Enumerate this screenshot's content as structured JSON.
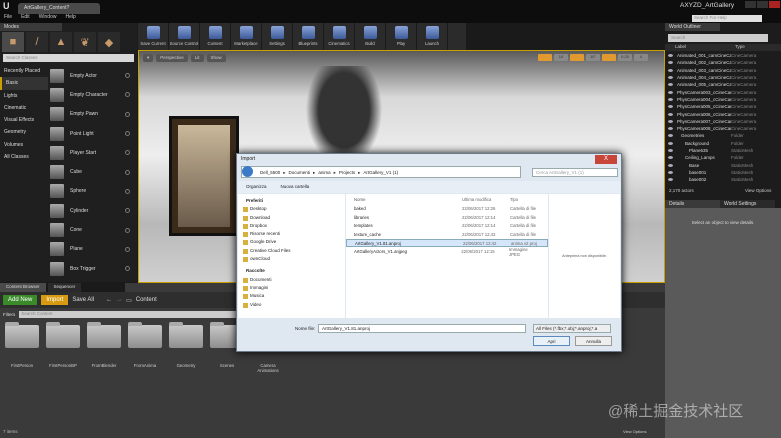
{
  "app": {
    "logo": "U",
    "tab_title": "ArtGallery_Content?",
    "project": "AXYZD_ArtGallery",
    "menu": [
      "File",
      "Edit",
      "Window",
      "Help"
    ],
    "help_placeholder": "Search For Help"
  },
  "modes": {
    "tab": "Modes",
    "search_placeholder": "Search Classes",
    "categories": [
      "Recently Placed",
      "Basic",
      "Lights",
      "Cinematic",
      "Visual Effects",
      "Geometry",
      "Volumes",
      "All Classes"
    ],
    "selected_category": "Basic",
    "items": [
      "Empty Actor",
      "Empty Character",
      "Empty Pawn",
      "Point Light",
      "Player Start",
      "Cube",
      "Sphere",
      "Cylinder",
      "Cone",
      "Plane",
      "Box Trigger"
    ]
  },
  "toolbar": [
    "Save Current",
    "Source Control",
    "Content",
    "Marketplace",
    "Settings",
    "Blueprints",
    "Cinematics",
    "Build",
    "Play",
    "Launch"
  ],
  "viewport": {
    "buttons": [
      "Perspective",
      "Lit",
      "Show"
    ],
    "right_values": [
      "10",
      "10°",
      "0.25",
      "4"
    ]
  },
  "outliner": {
    "tab": "World Outliner",
    "search_placeholder": "Search",
    "col_label": "Label",
    "col_type": "Type",
    "rows": [
      [
        "Animated_001_camCineCamera",
        "CineCamera"
      ],
      [
        "Animated_002_camCineCamera",
        "CineCamera"
      ],
      [
        "Animated_003_camCineCamera",
        "CineCamera"
      ],
      [
        "Animated_004_camCineCamera",
        "CineCamera"
      ],
      [
        "Animated_005_camCineCamera",
        "CineCamera"
      ],
      [
        "PhysCamera003_cCineCamera",
        "CineCamera"
      ],
      [
        "PhysCamera004_cCineCamera",
        "CineCamera"
      ],
      [
        "PhysCamera005_cCineCamera",
        "CineCamera"
      ],
      [
        "PhysCamera006_cCineCamera",
        "CineCamera"
      ],
      [
        "PhysCamera007_cCineCamera",
        "CineCamera"
      ],
      [
        "PhysCamera008_cCineCamera",
        "CineCamera"
      ],
      [
        "Geometries",
        "Folder"
      ],
      [
        "Background",
        "Folder"
      ],
      [
        "Plane635",
        "StaticMesh"
      ],
      [
        "Ceiling_Lamps",
        "Folder"
      ],
      [
        "Base",
        "StaticMesh"
      ],
      [
        "base001",
        "StaticMesh"
      ],
      [
        "base002",
        "StaticMesh"
      ]
    ],
    "count": "2,170 actors",
    "view_options": "View Options"
  },
  "details": {
    "tab": "Details",
    "tab2": "World Settings",
    "empty": "Select an object to view details."
  },
  "content_browser": {
    "tabs": [
      "Content Browser",
      "Sequencer"
    ],
    "add_new": "Add New",
    "import": "Import",
    "save_all": "Save All",
    "path": "Content",
    "filters": "Filters",
    "search_placeholder": "Search Content",
    "folders": [
      "FirstPerson",
      "FirstPersonBP",
      "FromBlender",
      "FromAnima",
      "Geometry",
      "Scenes",
      "Camera Animations"
    ],
    "count": "7 items",
    "view_options": "View Options"
  },
  "dialog": {
    "title": "Import",
    "close": "X",
    "path": [
      "Dell_5500",
      "Documenti",
      "anima",
      "Projects",
      "ArtGallery_V1 (1)"
    ],
    "search_placeholder": "Cerca ArtGallery_V1 (1)",
    "organize": "Organizza",
    "new_folder": "Nuova cartella",
    "nav": [
      {
        "h": true,
        "label": "Preferiti"
      },
      {
        "label": "Desktop"
      },
      {
        "label": "Download"
      },
      {
        "label": "Dropbox"
      },
      {
        "label": "Risorse recenti"
      },
      {
        "label": "Google Drive"
      },
      {
        "label": "Creative Cloud Files"
      },
      {
        "label": "ownCloud"
      },
      {
        "h": true,
        "label": "Raccolte"
      },
      {
        "label": "Documenti"
      },
      {
        "label": "Immagini"
      },
      {
        "label": "Musica"
      },
      {
        "label": "Video"
      }
    ],
    "headers": [
      "Nome",
      "Ultima modifica",
      "Tipo"
    ],
    "files": [
      [
        "baked",
        "22/06/2017 12:26",
        "Cartella di file"
      ],
      [
        "libraries",
        "22/06/2017 12:14",
        "Cartella di file"
      ],
      [
        "templates",
        "22/06/2017 12:14",
        "Cartella di file"
      ],
      [
        "texture_cache",
        "22/06/2017 12:43",
        "Cartella di file"
      ],
      [
        "ArtGallery_V1.81.anproj",
        "22/06/2017 12:42",
        "anima v2 proj"
      ],
      [
        "ArtGalleryActors_V1.anjpeg",
        "22/06/2017 12:15",
        "Immagine JPEG"
      ]
    ],
    "selected_file": "ArtGallery_V1.81.anproj",
    "preview": "Anteprima non disponibile.",
    "filename_label": "Nome file:",
    "filename": "ArtGallery_V1.81.anproj",
    "filter": "All Files (*.fbx;*.obj;*.anproj;*.a",
    "open": "Apri",
    "cancel": "Annulla"
  },
  "watermark": "@稀土掘金技术社区"
}
